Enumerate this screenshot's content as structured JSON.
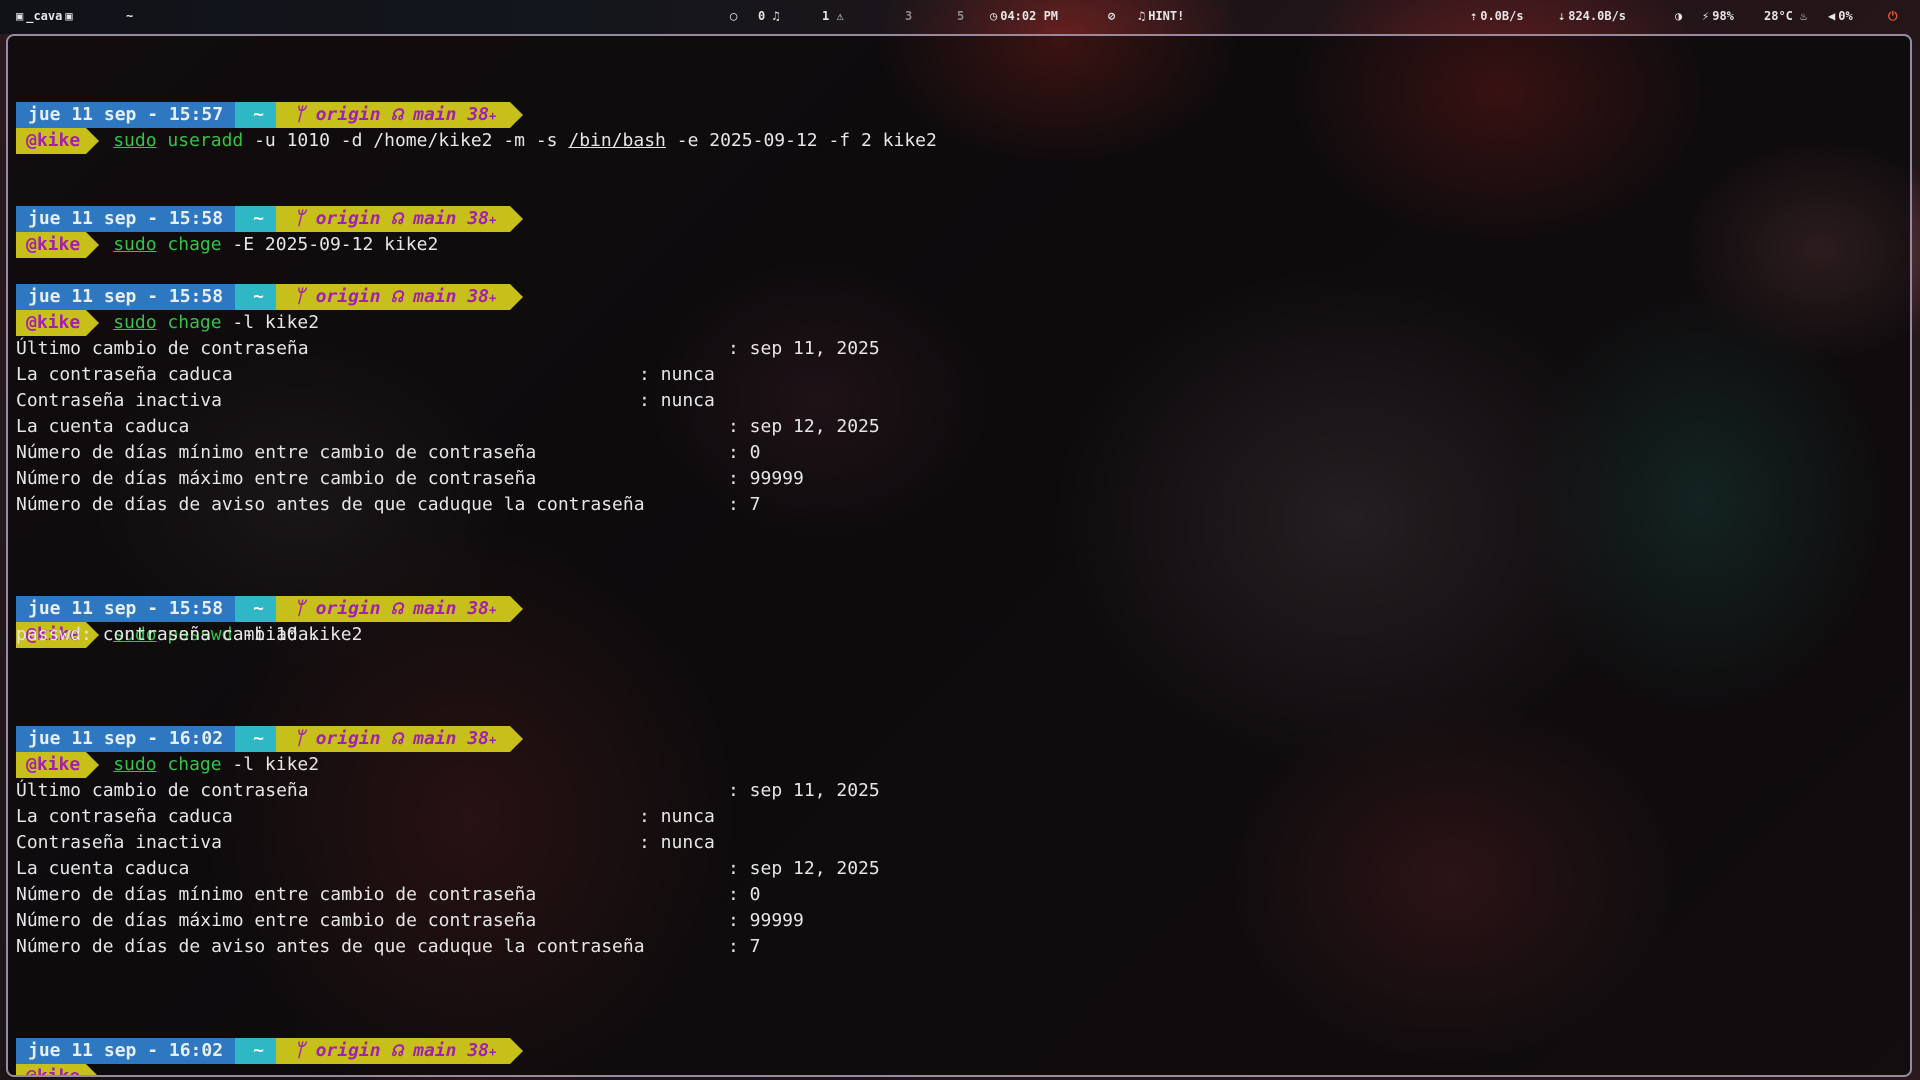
{
  "topbar": {
    "left_window": "_cava",
    "left_dir": "~",
    "ws_0": "0",
    "ws_1": "1",
    "ws_3": "3",
    "ws_5": "5",
    "clock": "04:02 PM",
    "hint": "HINT!",
    "net_up": "0.0B/s",
    "net_down": "824.0B/s",
    "battery": "98%",
    "temp": "28°C",
    "volume": "0%"
  },
  "prompts": [
    {
      "date": "jue 11 sep - 15:57",
      "dir": "~",
      "git": "origin",
      "branch": "main 38"
    },
    {
      "date": "jue 11 sep - 15:58",
      "dir": "~",
      "git": "origin",
      "branch": "main 38"
    },
    {
      "date": "jue 11 sep - 15:58",
      "dir": "~",
      "git": "origin",
      "branch": "main 38"
    },
    {
      "date": "jue 11 sep - 15:58",
      "dir": "~",
      "git": "origin",
      "branch": "main 38"
    },
    {
      "date": "jue 11 sep - 16:02",
      "dir": "~",
      "git": "origin",
      "branch": "main 38"
    },
    {
      "date": "jue 11 sep - 16:02",
      "dir": "~",
      "git": "origin",
      "branch": "main 38"
    }
  ],
  "user": "@kike",
  "commands": {
    "c0": {
      "sudo": "sudo",
      "prog": "useradd",
      "args1": " -u 1010 -d /home/kike2 -m -s ",
      "path": "/bin/bash",
      "args2": " -e 2025-09-12 -f 2 kike2"
    },
    "c1": {
      "sudo": "sudo",
      "prog": "chage",
      "args": " -E 2025-09-12 kike2"
    },
    "c2": {
      "sudo": "sudo",
      "prog": "chage",
      "args": " -l kike2"
    },
    "c3": {
      "sudo": "sudo",
      "prog": "passwd",
      "args": " -i 10 kike2"
    },
    "c4": {
      "sudo": "sudo",
      "prog": "chage",
      "args": " -l kike2"
    }
  },
  "chage_output": [
    {
      "label": "Último cambio de contraseña",
      "value": ": sep 11, 2025"
    },
    {
      "label": "La contraseña caduca",
      "value": ": nunca"
    },
    {
      "label": "Contraseña inactiva",
      "value": ": nunca"
    },
    {
      "label": "La cuenta caduca",
      "value": ": sep 12, 2025"
    },
    {
      "label": "Número de días mínimo entre cambio de contraseña",
      "value": ": 0"
    },
    {
      "label": "Número de días máximo entre cambio de contraseña",
      "value": ": 99999"
    },
    {
      "label": "Número de días de aviso antes de que caduque la contraseña",
      "value": ": 7"
    }
  ],
  "passwd_output": "passwd: contraseña cambiada."
}
